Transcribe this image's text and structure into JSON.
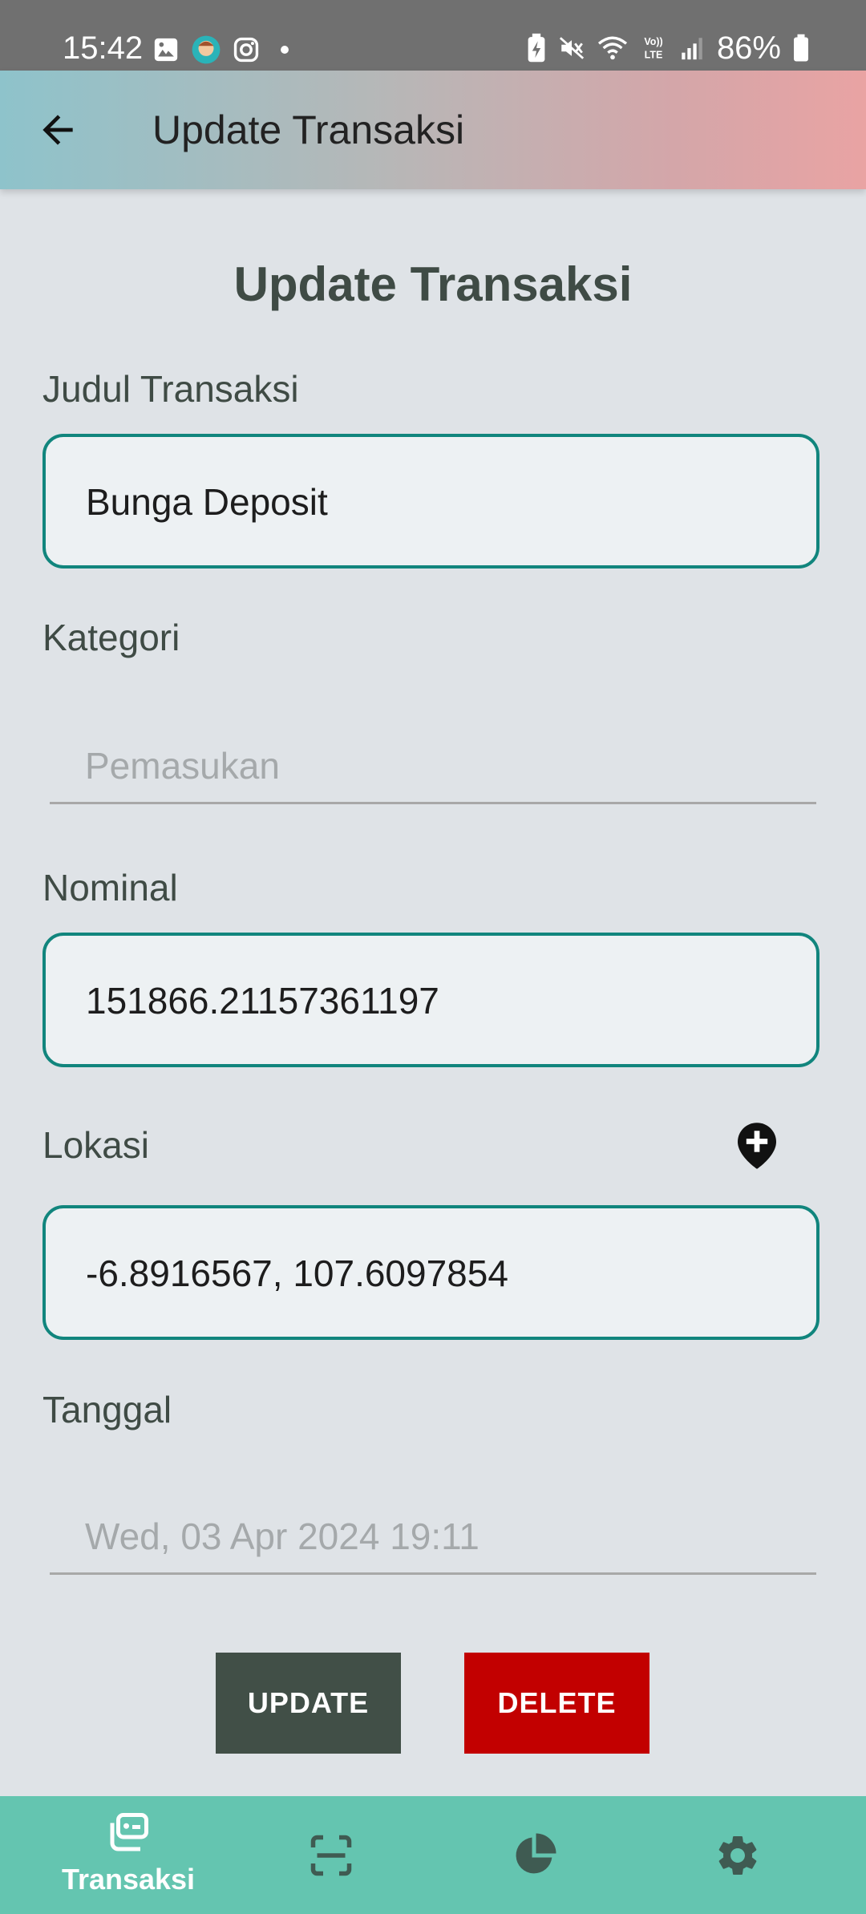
{
  "status_bar": {
    "time": "15:42",
    "battery_text": "86%",
    "left_icons": [
      "gallery-icon",
      "app-avatar-icon",
      "instagram-icon",
      "dot-icon"
    ],
    "right_icons": [
      "battery-saver-icon",
      "mute-icon",
      "wifi-icon",
      "volte-icon",
      "signal-icon",
      "battery-icon"
    ]
  },
  "app_bar": {
    "title": "Update Transaksi",
    "back_icon": "arrow-back-icon"
  },
  "form": {
    "heading": "Update Transaksi",
    "judul": {
      "label": "Judul Transaksi",
      "value": "Bunga Deposit"
    },
    "kategori": {
      "label": "Kategori",
      "value": "Pemasukan"
    },
    "nominal": {
      "label": "Nominal",
      "value": "151866.21157361197"
    },
    "lokasi": {
      "label": "Lokasi",
      "value": "-6.8916567, 107.6097854",
      "action_icon": "add-location-icon"
    },
    "tanggal": {
      "label": "Tanggal",
      "value": "Wed, 03 Apr 2024 19:11"
    }
  },
  "actions": {
    "update_label": "UPDATE",
    "delete_label": "DELETE"
  },
  "bottom_nav": {
    "items": [
      {
        "label": "Transaksi",
        "icon": "transactions-icon",
        "active": true
      },
      {
        "label": "",
        "icon": "scan-icon",
        "active": false
      },
      {
        "label": "",
        "icon": "pie-chart-icon",
        "active": false
      },
      {
        "label": "",
        "icon": "settings-gear-icon",
        "active": false
      }
    ]
  },
  "colors": {
    "accent": "#11857d",
    "update_button": "#414f47",
    "delete_button": "#c20000",
    "bottom_nav": "#64c5b0",
    "background": "#dfe3e7"
  }
}
